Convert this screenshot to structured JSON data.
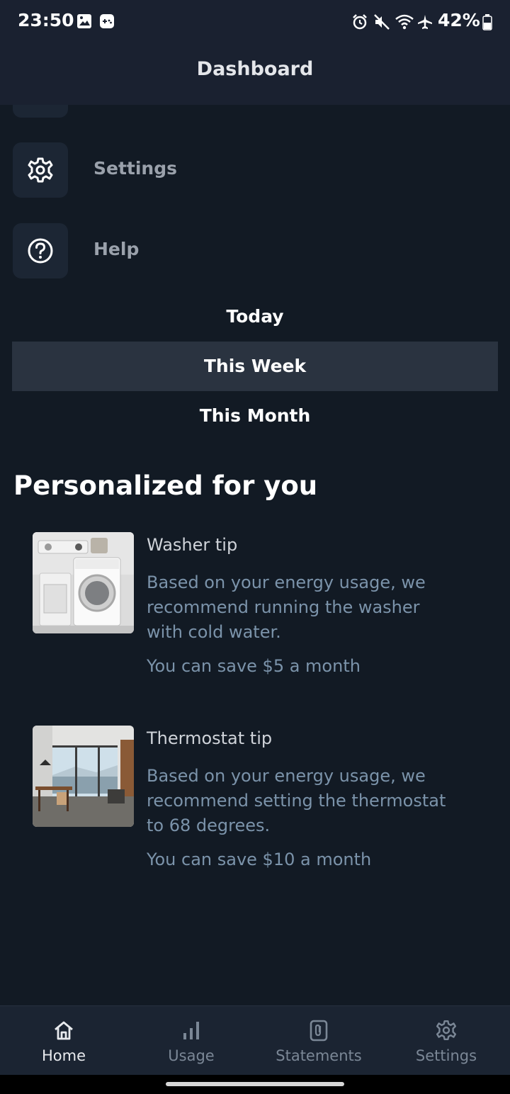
{
  "status_bar": {
    "time": "23:50",
    "battery": "42%",
    "left_icons": [
      "image-icon",
      "game-controller-icon"
    ],
    "right_icons": [
      "alarm-icon",
      "mute-icon",
      "wifi-icon",
      "airplane-icon",
      "battery-icon"
    ]
  },
  "appbar": {
    "title": "Dashboard"
  },
  "menu": {
    "items": [
      {
        "label": "Settings",
        "icon": "gear-icon"
      },
      {
        "label": "Help",
        "icon": "help-circle-icon"
      }
    ]
  },
  "periods": {
    "options": [
      "Today",
      "This Week",
      "This Month"
    ],
    "selected": "This Week"
  },
  "personalized": {
    "title": "Personalized for you",
    "tips": [
      {
        "title": "Washer tip",
        "body": "Based on your energy usage, we recommend running the washer with cold water.",
        "savings": "You can save $5 a month",
        "image": "washing-machine-photo"
      },
      {
        "title": "Thermostat tip",
        "body": "Based on your energy usage, we recommend setting the thermostat to 68 degrees.",
        "savings": "You can save $10 a month",
        "image": "living-room-photo"
      }
    ]
  },
  "bottom_nav": {
    "items": [
      {
        "label": "Home",
        "icon": "home-icon"
      },
      {
        "label": "Usage",
        "icon": "bar-chart-icon"
      },
      {
        "label": "Statements",
        "icon": "document-icon"
      },
      {
        "label": "Settings",
        "icon": "gear-icon"
      }
    ],
    "active": "Home"
  },
  "colors": {
    "background": "#121a24",
    "header": "#1a2130",
    "selected_row": "#2a3340",
    "muted_text": "#7b93aa"
  }
}
